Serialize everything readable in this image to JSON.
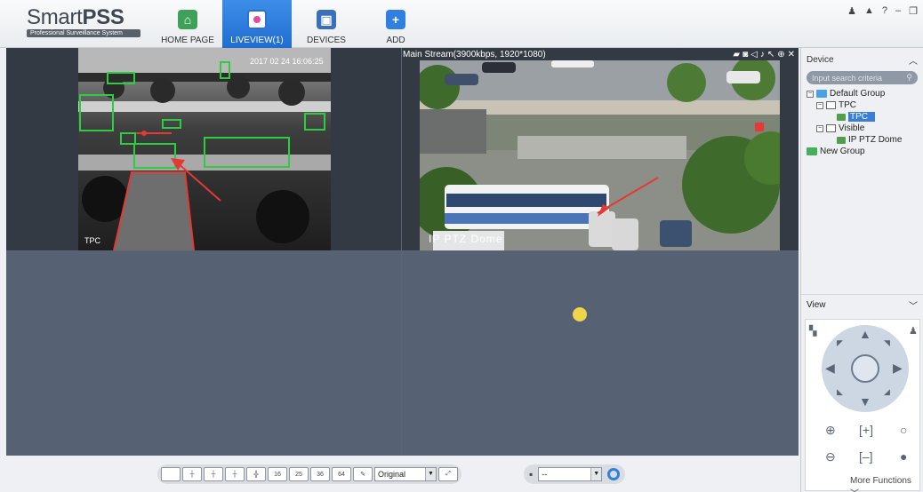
{
  "app": {
    "logo": {
      "name_light": "Smart",
      "name_bold": "PSS",
      "tagline": "Professional Surveillance System"
    },
    "nav": [
      {
        "label": "HOME PAGE",
        "icon": "home-icon"
      },
      {
        "label": "LIVEVIEW(1)",
        "icon": "liveview-icon",
        "active": true
      },
      {
        "label": "DEVICES",
        "icon": "devices-icon"
      },
      {
        "label": "ADD",
        "icon": "add-icon"
      }
    ],
    "window_controls": [
      "user-icon",
      "lock-icon",
      "help-icon",
      "minimize-icon",
      "restore-icon"
    ]
  },
  "video": {
    "cells": [
      {
        "camera": "TPC",
        "timestamp": "2017 02 24 16:06:25"
      },
      {
        "stream_label": "Main Stream(3900kbps, 1920*1080)",
        "camera": "IP PTZ Dome"
      }
    ]
  },
  "toolbar": {
    "layout_buttons": [
      "1",
      "4",
      "6",
      "8",
      "9",
      "16",
      "25",
      "36",
      "64"
    ],
    "stream_select": "Original",
    "save_select": "--"
  },
  "panel": {
    "device_title": "Device",
    "search_placeholder": "Input search criteria",
    "tree": [
      {
        "label": "Default Group",
        "level": 0
      },
      {
        "label": "TPC",
        "level": 1
      },
      {
        "label": "TPC",
        "level": 2,
        "selected": true
      },
      {
        "label": "Visible",
        "level": 1
      },
      {
        "label": "IP PTZ Dome",
        "level": 2
      },
      {
        "label": "New Group",
        "level": 0
      }
    ],
    "view_title": "View",
    "more_functions": "More Functions"
  },
  "colors": {
    "accent": "#2f80e0",
    "detection_box": "#2ecc40",
    "alarm": "#e53935"
  }
}
